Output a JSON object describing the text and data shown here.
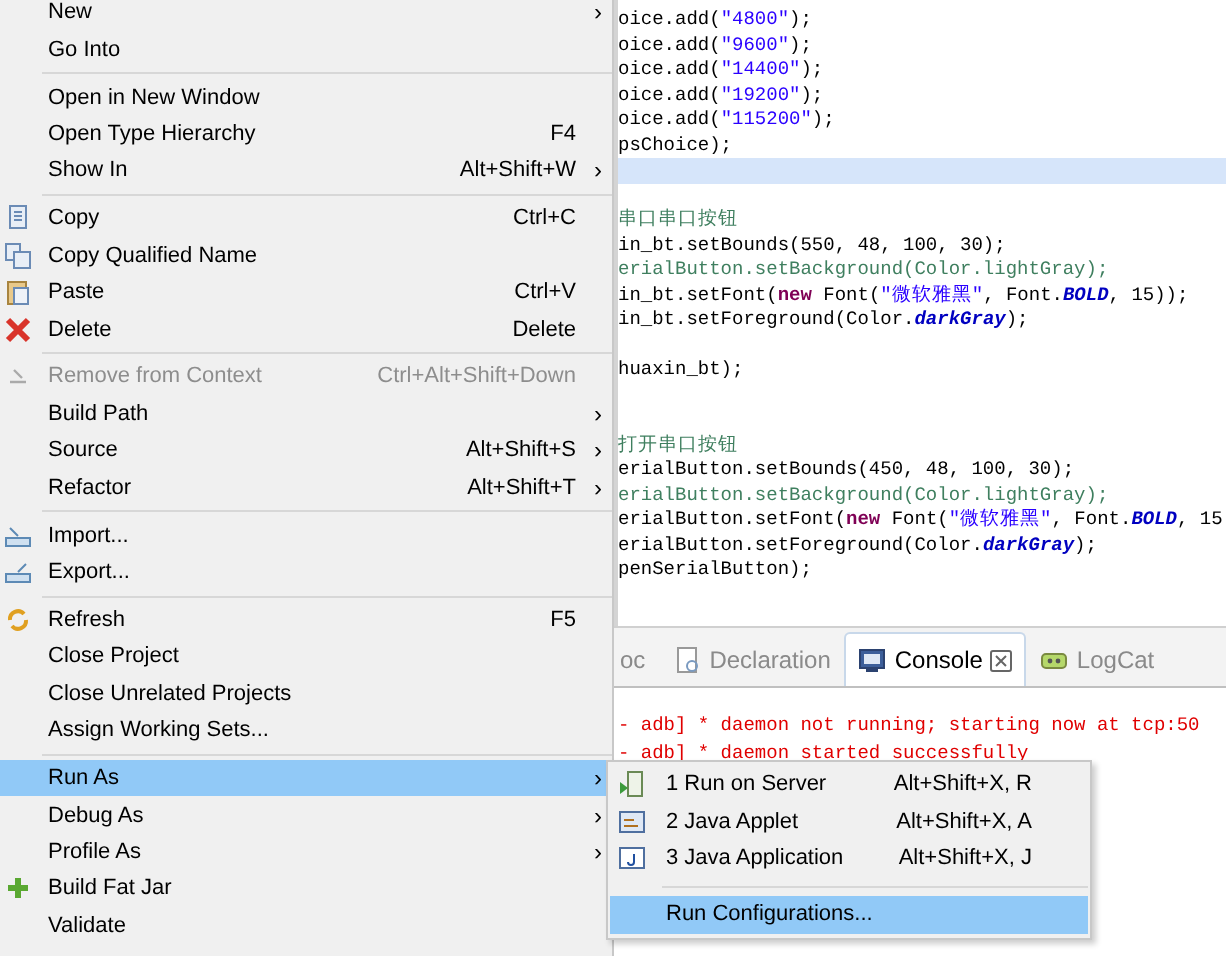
{
  "context_menu": {
    "items": [
      {
        "kind": "item",
        "label": "New",
        "arrow": "›",
        "selected": false,
        "disabled": false
      },
      {
        "kind": "item",
        "label": "Go Into",
        "selected": false,
        "disabled": false
      },
      {
        "kind": "separator"
      },
      {
        "kind": "item",
        "label": "Open in New Window",
        "selected": false,
        "disabled": false
      },
      {
        "kind": "item",
        "label": "Open Type Hierarchy",
        "shortcut": "F4",
        "selected": false,
        "disabled": false
      },
      {
        "kind": "item",
        "label": "Show In",
        "shortcut": "Alt+Shift+W",
        "arrow": "›",
        "selected": false,
        "disabled": false
      },
      {
        "kind": "separator"
      },
      {
        "kind": "item",
        "label": "Copy",
        "shortcut": "Ctrl+C",
        "selected": false,
        "disabled": false
      },
      {
        "kind": "item",
        "label": "Copy Qualified Name",
        "selected": false,
        "disabled": false
      },
      {
        "kind": "item",
        "label": "Paste",
        "shortcut": "Ctrl+V",
        "selected": false,
        "disabled": false
      },
      {
        "kind": "item",
        "label": "Delete",
        "shortcut": "Delete",
        "selected": false,
        "disabled": false
      },
      {
        "kind": "separator"
      },
      {
        "kind": "item",
        "label": "Remove from Context",
        "shortcut": "Ctrl+Alt+Shift+Down",
        "selected": false,
        "disabled": true
      },
      {
        "kind": "item",
        "label": "Build Path",
        "arrow": "›",
        "selected": false,
        "disabled": false
      },
      {
        "kind": "item",
        "label": "Source",
        "shortcut": "Alt+Shift+S",
        "arrow": "›",
        "selected": false,
        "disabled": false
      },
      {
        "kind": "item",
        "label": "Refactor",
        "shortcut": "Alt+Shift+T",
        "arrow": "›",
        "selected": false,
        "disabled": false
      },
      {
        "kind": "separator"
      },
      {
        "kind": "item",
        "label": "Import...",
        "selected": false,
        "disabled": false
      },
      {
        "kind": "item",
        "label": "Export...",
        "selected": false,
        "disabled": false
      },
      {
        "kind": "separator"
      },
      {
        "kind": "item",
        "label": "Refresh",
        "shortcut": "F5",
        "selected": false,
        "disabled": false
      },
      {
        "kind": "item",
        "label": "Close Project",
        "selected": false,
        "disabled": false
      },
      {
        "kind": "item",
        "label": "Close Unrelated Projects",
        "selected": false,
        "disabled": false
      },
      {
        "kind": "item",
        "label": "Assign Working Sets...",
        "selected": false,
        "disabled": false
      },
      {
        "kind": "separator"
      },
      {
        "kind": "item",
        "label": "Run As",
        "arrow": "›",
        "selected": true,
        "disabled": false
      },
      {
        "kind": "item",
        "label": "Debug As",
        "arrow": "›",
        "selected": false,
        "disabled": false
      },
      {
        "kind": "item",
        "label": "Profile As",
        "arrow": "›",
        "selected": false,
        "disabled": false
      },
      {
        "kind": "item",
        "label": "Build Fat Jar",
        "selected": false,
        "disabled": false
      },
      {
        "kind": "item",
        "label": "Validate",
        "selected": false,
        "disabled": false
      }
    ]
  },
  "submenu": {
    "items": [
      {
        "kind": "item",
        "label": "1 Run on Server",
        "shortcut": "Alt+Shift+X, R",
        "selected": false
      },
      {
        "kind": "item",
        "label": "2 Java Applet",
        "shortcut": "Alt+Shift+X, A",
        "selected": false
      },
      {
        "kind": "item",
        "label": "3 Java Application",
        "shortcut": "Alt+Shift+X, J",
        "selected": false
      },
      {
        "kind": "separator"
      },
      {
        "kind": "item",
        "label": "Run Configurations...",
        "selected": true
      }
    ]
  },
  "editor": {
    "lines": [
      {
        "highlighted": false,
        "tokens": [
          {
            "text": "oice.add(",
            "kind": "plain"
          },
          {
            "text": "\"4800\"",
            "kind": "string"
          },
          {
            "text": ");",
            "kind": "plain"
          }
        ]
      },
      {
        "highlighted": false,
        "tokens": [
          {
            "text": "oice.add(",
            "kind": "plain"
          },
          {
            "text": "\"9600\"",
            "kind": "string"
          },
          {
            "text": ");",
            "kind": "plain"
          }
        ]
      },
      {
        "highlighted": false,
        "tokens": [
          {
            "text": "oice.add(",
            "kind": "plain"
          },
          {
            "text": "\"14400\"",
            "kind": "string"
          },
          {
            "text": ");",
            "kind": "plain"
          }
        ]
      },
      {
        "highlighted": false,
        "tokens": [
          {
            "text": "oice.add(",
            "kind": "plain"
          },
          {
            "text": "\"19200\"",
            "kind": "string"
          },
          {
            "text": ");",
            "kind": "plain"
          }
        ]
      },
      {
        "highlighted": false,
        "tokens": [
          {
            "text": "oice.add(",
            "kind": "plain"
          },
          {
            "text": "\"115200\"",
            "kind": "string"
          },
          {
            "text": ");",
            "kind": "plain"
          }
        ]
      },
      {
        "highlighted": false,
        "tokens": [
          {
            "text": "psChoice);",
            "kind": "plain"
          }
        ]
      },
      {
        "highlighted": true
      },
      {
        "highlighted": false
      },
      {
        "highlighted": false,
        "tokens": [
          {
            "text": "串口串口按钮",
            "kind": "comment"
          }
        ]
      },
      {
        "highlighted": false,
        "tokens": [
          {
            "text": "in_bt.setBounds(550, 48, 100, 30);",
            "kind": "plain"
          }
        ]
      },
      {
        "highlighted": false,
        "tokens": [
          {
            "text": "erialButton.setBackground(Color.lightGray);",
            "kind": "comment"
          }
        ]
      },
      {
        "highlighted": false,
        "tokens": [
          {
            "text": "in_bt.setFont(",
            "kind": "plain"
          },
          {
            "text": "new",
            "kind": "keyword"
          },
          {
            "text": " Font(",
            "kind": "plain"
          },
          {
            "text": "\"微软雅黑\"",
            "kind": "string"
          },
          {
            "text": ", Font.",
            "kind": "plain"
          },
          {
            "text": "BOLD",
            "kind": "constant"
          },
          {
            "text": ", 15));",
            "kind": "plain"
          }
        ]
      },
      {
        "highlighted": false,
        "tokens": [
          {
            "text": "in_bt.setForeground(Color.",
            "kind": "plain"
          },
          {
            "text": "darkGray",
            "kind": "constant"
          },
          {
            "text": ");",
            "kind": "plain"
          }
        ]
      },
      {
        "highlighted": false
      },
      {
        "highlighted": false,
        "tokens": [
          {
            "text": "huaxin_bt);",
            "kind": "plain"
          }
        ]
      },
      {
        "highlighted": false
      },
      {
        "highlighted": false
      },
      {
        "highlighted": false,
        "tokens": [
          {
            "text": "打开串口按钮",
            "kind": "comment"
          }
        ]
      },
      {
        "highlighted": false,
        "tokens": [
          {
            "text": "erialButton.setBounds(450, 48, 100, 30);",
            "kind": "plain"
          }
        ]
      },
      {
        "highlighted": false,
        "tokens": [
          {
            "text": "erialButton.setBackground(Color.lightGray);",
            "kind": "comment"
          }
        ]
      },
      {
        "highlighted": false,
        "tokens": [
          {
            "text": "erialButton.setFont(",
            "kind": "plain"
          },
          {
            "text": "new",
            "kind": "keyword"
          },
          {
            "text": " Font(",
            "kind": "plain"
          },
          {
            "text": "\"微软雅黑\"",
            "kind": "string"
          },
          {
            "text": ", Font.",
            "kind": "plain"
          },
          {
            "text": "BOLD",
            "kind": "constant"
          },
          {
            "text": ", 15",
            "kind": "plain"
          }
        ]
      },
      {
        "highlighted": false,
        "tokens": [
          {
            "text": "erialButton.setForeground(Color.",
            "kind": "plain"
          },
          {
            "text": "darkGray",
            "kind": "constant"
          },
          {
            "text": ");",
            "kind": "plain"
          }
        ]
      },
      {
        "highlighted": false,
        "tokens": [
          {
            "text": "penSerialButton);",
            "kind": "plain"
          }
        ]
      }
    ]
  },
  "console": {
    "tabs": [
      {
        "label": "oc",
        "selected": false
      },
      {
        "label": "Declaration",
        "selected": false
      },
      {
        "label": "Console",
        "selected": true
      },
      {
        "label": "LogCat",
        "selected": false
      }
    ],
    "lines": [
      "- adb] * daemon not running; starting now at tcp:50",
      "- adb] * daemon started successfully"
    ]
  }
}
